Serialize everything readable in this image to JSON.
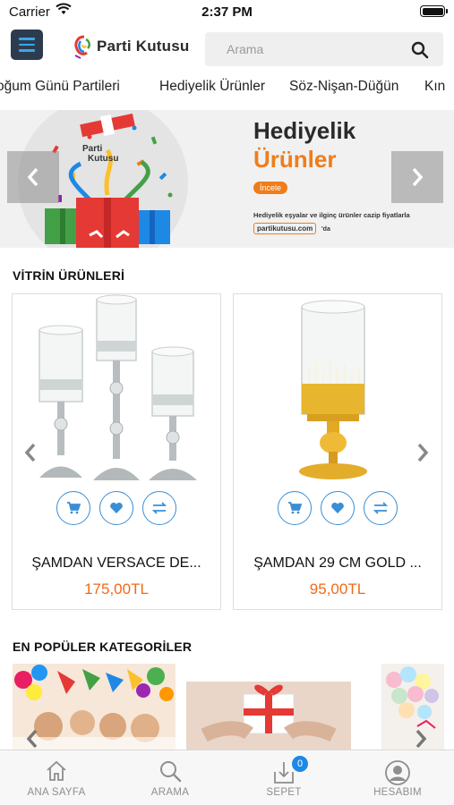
{
  "status": {
    "carrier": "Carrier",
    "time": "2:37 PM"
  },
  "header": {
    "logo_text": "Parti Kutusu",
    "search_placeholder": "Arama"
  },
  "categories_strip": [
    "oğum Günü Partileri",
    "Hediyelik Ürünler",
    "Söz-Nişan-Düğün",
    "Kın"
  ],
  "banner": {
    "title_line1": "Hediyelik",
    "title_line2": "Ürünler",
    "button": "İncele",
    "description": "Hediyelik eşyalar ve ilginç ürünler cazip fiyatlarla",
    "url": "partikutusu.com",
    "url_suffix": "'da",
    "logo_text_line1": "Parti",
    "logo_text_line2": "Kutusu"
  },
  "showcase": {
    "title": "VİTRİN ÜRÜNLERİ",
    "products": [
      {
        "name": "ŞAMDAN VERSACE DE...",
        "price": "175,00TL"
      },
      {
        "name": "ŞAMDAN 29 CM GOLD ...",
        "price": "95,00TL"
      }
    ]
  },
  "popular": {
    "title": "EN POPÜLER KATEGORİLER"
  },
  "tabbar": {
    "items": [
      {
        "label": "ANA SAYFA",
        "icon": "home-icon"
      },
      {
        "label": "ARAMA",
        "icon": "search-icon"
      },
      {
        "label": "SEPET",
        "icon": "cart-icon",
        "badge": "0"
      },
      {
        "label": "HESABIM",
        "icon": "account-icon"
      }
    ]
  },
  "colors": {
    "accent_blue": "#3a8ed6",
    "price_orange": "#ef6a18",
    "menu_bg": "#2d3b4f"
  }
}
